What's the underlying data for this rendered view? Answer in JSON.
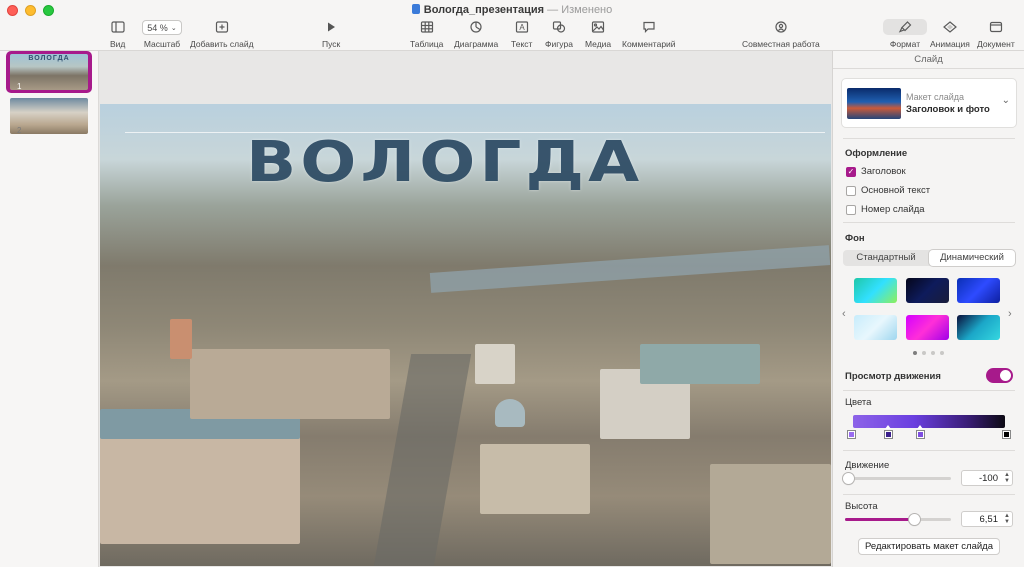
{
  "window": {
    "doc_name": "Вологда_презентация",
    "separator": "—",
    "status": "Изменено"
  },
  "toolbar": {
    "view": "Вид",
    "zoom_value": "54 %",
    "zoom": "Масштаб",
    "add_slide": "Добавить слайд",
    "play": "Пуск",
    "table": "Таблица",
    "chart": "Диаграмма",
    "text": "Текст",
    "shape": "Фигура",
    "media": "Медиа",
    "comment": "Комментарий",
    "collaborate": "Совместная работа",
    "format": "Формат",
    "animate": "Анимация",
    "document": "Документ"
  },
  "navigator": {
    "slides": [
      {
        "number": "1",
        "title": "ВОЛОГДА"
      },
      {
        "number": "2"
      }
    ]
  },
  "slide": {
    "title": "ВОЛОГДА"
  },
  "inspector": {
    "header": "Слайд",
    "layout": {
      "label": "Макет слайда",
      "value": "Заголовок и фото"
    },
    "appearance": {
      "title": "Оформление",
      "title_checkbox": "Заголовок",
      "body_checkbox": "Основной текст",
      "slide_number_checkbox": "Номер слайда",
      "title_checked": true,
      "body_checked": false,
      "slide_number_checked": false
    },
    "background": {
      "title": "Фон",
      "standard": "Стандартный",
      "dynamic": "Динамический",
      "selected": "Динамический",
      "swatches": [
        {
          "name": "swatch-rainbow",
          "colors": [
            "#1ec7a8",
            "#32e0ff",
            "#8ef05a"
          ]
        },
        {
          "name": "swatch-dark-blue",
          "colors": [
            "#05061a",
            "#0e1b5c",
            "#1a1d3a"
          ]
        },
        {
          "name": "swatch-blue",
          "colors": [
            "#0a2fb5",
            "#2e4bff",
            "#0d1fa0"
          ]
        },
        {
          "name": "swatch-light-blue",
          "colors": [
            "#c7ecfb",
            "#e8f7fd",
            "#9fd6ef"
          ]
        },
        {
          "name": "swatch-magenta",
          "colors": [
            "#d400ff",
            "#ff2fd8",
            "#a100e8"
          ]
        },
        {
          "name": "swatch-teal",
          "colors": [
            "#0b0f3a",
            "#1ba7c8",
            "#35d7e0"
          ]
        }
      ],
      "page_count": 4,
      "current_page": 1
    },
    "motion_preview": {
      "label": "Просмотр движения",
      "on": true
    },
    "colors": {
      "title": "Цвета",
      "stops": [
        "#9a6cf0",
        "#3b1f8c",
        "#7e4ee0",
        "#000000"
      ]
    },
    "motion": {
      "title": "Движение",
      "value": "-100",
      "fraction": 0.0
    },
    "height": {
      "title": "Высота",
      "value": "6,51",
      "fraction": 0.65
    },
    "edit_layout": "Редактировать макет слайда"
  },
  "accent_color": "#a71a8b"
}
